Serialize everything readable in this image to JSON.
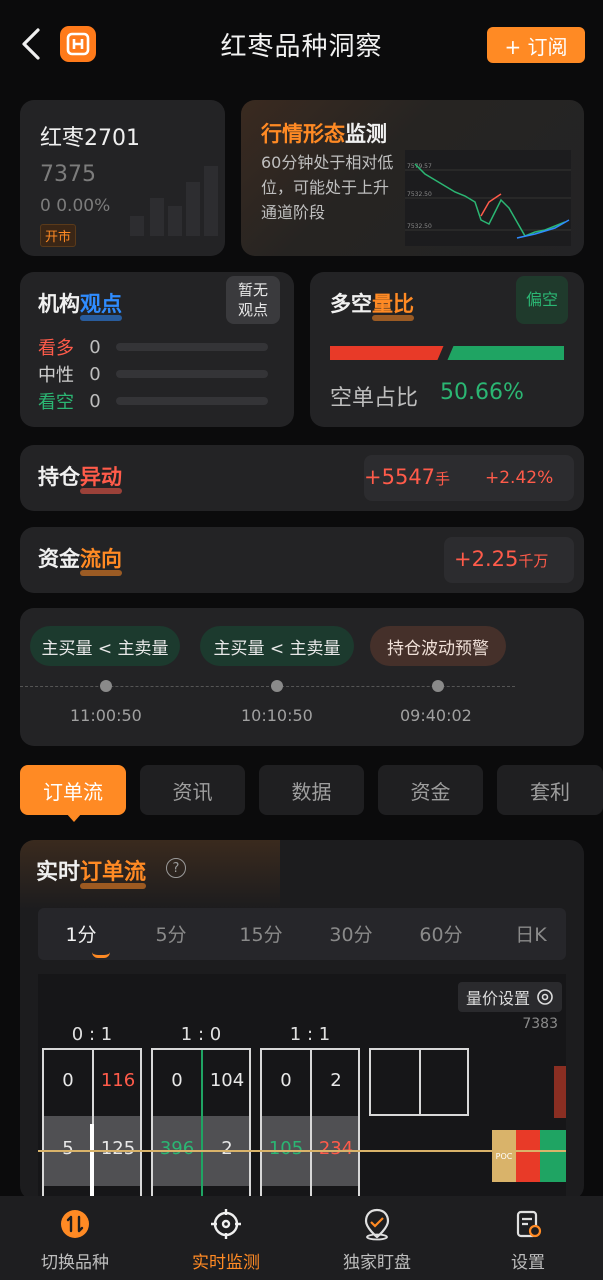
{
  "header": {
    "title": "红枣品种洞察",
    "subscribe_label": "+ 订阅"
  },
  "contract": {
    "name": "红枣2701",
    "price": "7375",
    "change": "0  0.00%",
    "status": "开市"
  },
  "trend": {
    "title_plain": "行情形态",
    "title_highlight": "监测",
    "description": "60分钟处于相对低位，可能处于上升通道阶段",
    "axis_labels": [
      "7579.57",
      "7532.50",
      "7532.50"
    ]
  },
  "views": {
    "title_plain": "机构",
    "title_highlight": "观点",
    "badge": "暂无观点",
    "rows": [
      {
        "label": "看多",
        "value": "0",
        "color": "#ff5b4a"
      },
      {
        "label": "中性",
        "value": "0",
        "color": "#d0d0d0"
      },
      {
        "label": "看空",
        "value": "0",
        "color": "#2bb673"
      }
    ]
  },
  "longshort": {
    "title_plain": "多空",
    "title_highlight": "量比",
    "badge": "偏空",
    "ratio_label": "空单占比",
    "ratio_value": "50.66%",
    "short_share_percent": 50.66
  },
  "position_change": {
    "title_plain": "持仓",
    "title_highlight": "异动",
    "value": "+5547",
    "unit": "手",
    "percent": "+2.42%"
  },
  "fund_flow": {
    "title_plain": "资金",
    "title_highlight": "流向",
    "value": "+2.25",
    "unit": "千万"
  },
  "alerts": {
    "items": [
      {
        "label": "主买量 < 主卖量",
        "time": "11:00:50",
        "kind": "green"
      },
      {
        "label": "主买量 < 主卖量",
        "time": "10:10:50",
        "kind": "green"
      },
      {
        "label": "持仓波动预警",
        "time": "09:40:02",
        "kind": "red"
      }
    ]
  },
  "tabs": [
    "订单流",
    "资讯",
    "数据",
    "资金",
    "套利"
  ],
  "orderflow": {
    "title_plain": "实时",
    "title_highlight": "订单流",
    "help": "?",
    "periods": [
      "1分",
      "5分",
      "15分",
      "30分",
      "60分",
      "日K"
    ],
    "settings_label": "量价设置",
    "high_price": "7383",
    "poc_label": "POC",
    "bars": [
      {
        "ratio": "0  :  1",
        "top_left": "0",
        "top_right": "116",
        "bottom_left": "5",
        "bottom_right": "125"
      },
      {
        "ratio": "1  :  0",
        "top_left": "0",
        "top_right": "104",
        "bottom_left": "396",
        "bottom_right": "2"
      },
      {
        "ratio": "1  :  1",
        "top_left": "0",
        "top_right": "2",
        "bottom_left": "105",
        "bottom_right": "234"
      }
    ]
  },
  "nav": [
    {
      "label": "切换品种",
      "icon": "switch-icon"
    },
    {
      "label": "实时监测",
      "icon": "target-icon"
    },
    {
      "label": "独家盯盘",
      "icon": "watch-icon"
    },
    {
      "label": "设置",
      "icon": "settings-icon"
    }
  ],
  "colors": {
    "accent": "#ff8a24",
    "up": "#ff5b4a",
    "down": "#2bb673",
    "card": "#232325"
  }
}
